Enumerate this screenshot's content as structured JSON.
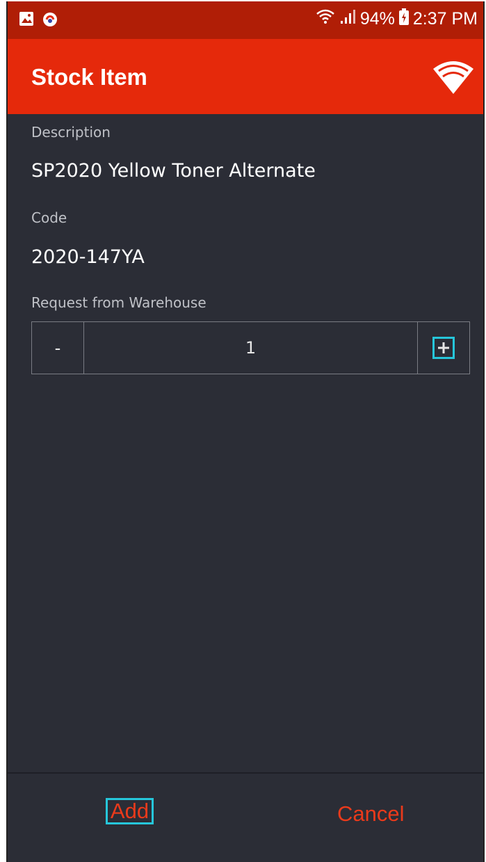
{
  "status_bar": {
    "icons_left": [
      "gallery-icon",
      "app-notification-icon"
    ],
    "wifi_icon": "wifi-icon",
    "signal_icon": "signal-icon",
    "battery_percent": "94%",
    "battery_icon": "battery-charging-icon",
    "time": "2:37 PM"
  },
  "app_bar": {
    "title": "Stock Item",
    "action_icon": "wifi-icon"
  },
  "form": {
    "description_label": "Description",
    "description_value": "SP2020 Yellow Toner Alternate",
    "code_label": "Code",
    "code_value": "2020-147YA",
    "request_label": "Request from Warehouse",
    "quantity": {
      "decrement_label": "-",
      "value": "1",
      "increment_icon": "plus-icon"
    }
  },
  "actions": {
    "add_label": "Add",
    "cancel_label": "Cancel"
  },
  "colors": {
    "status_bar": "#b01e06",
    "app_bar": "#e5290b",
    "background": "#2b2d36",
    "accent": "#ea3a1b",
    "highlight": "#26c6da"
  }
}
